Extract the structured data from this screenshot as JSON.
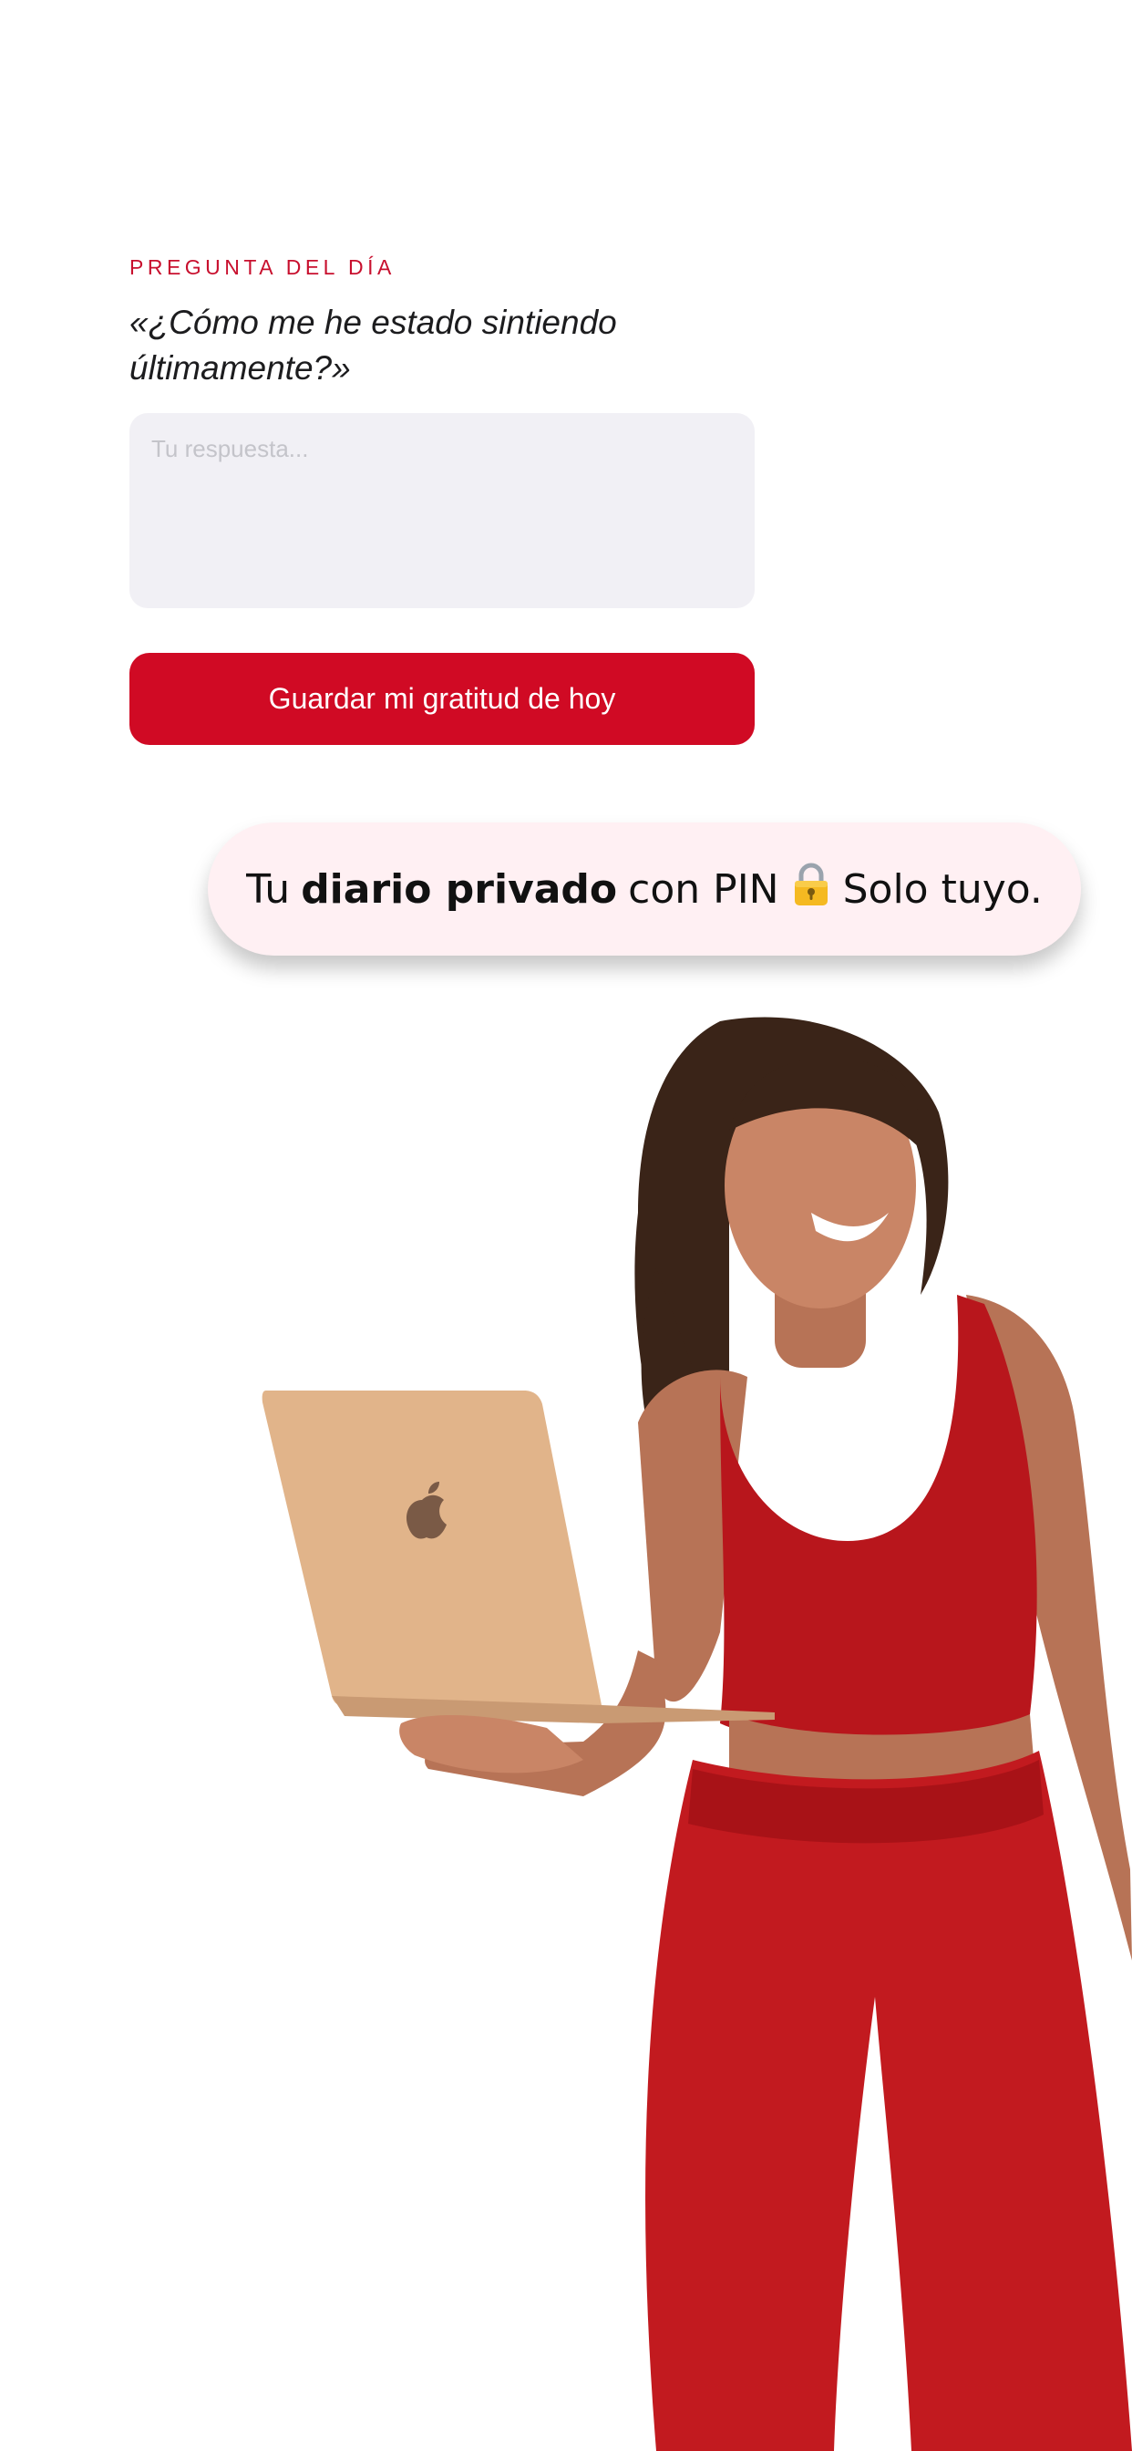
{
  "card": {
    "eyebrow": "PREGUNTA DEL DÍA",
    "question": "«¿Cómo me he estado sintiendo últimamente?»",
    "answer_placeholder": "Tu respuesta...",
    "answer_value": "",
    "save_button": "Guardar mi gratitud de hoy"
  },
  "banner": {
    "prefix": "Tu",
    "bold": "diario privado",
    "middle": "con PIN",
    "lock_icon": "lock-icon",
    "suffix": "Solo tuyo."
  },
  "photo": {
    "subject": "woman-holding-laptop",
    "laptop_icon": "apple-logo-icon"
  },
  "colors": {
    "accent": "#c8102e",
    "button": "#d00a24",
    "input_bg": "#f1f0f5",
    "pill_bg": "#fff0f3",
    "outfit": "#c21a1f"
  }
}
